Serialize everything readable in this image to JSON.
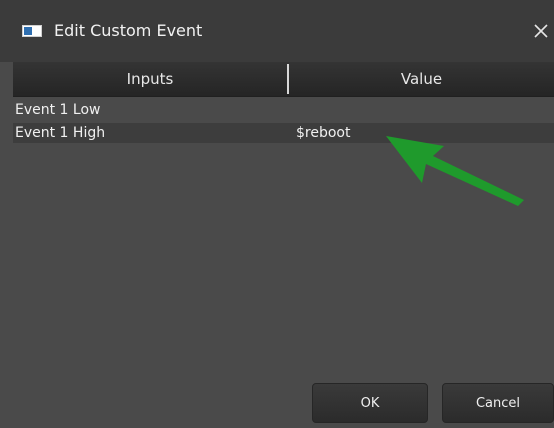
{
  "window": {
    "title": "Edit Custom Event",
    "close_glyph": "✕"
  },
  "table": {
    "columns": [
      "Inputs",
      "Value"
    ],
    "rows": [
      {
        "input": "Event 1 Low",
        "value": ""
      },
      {
        "input": "Event 1 High",
        "value": "$reboot"
      }
    ]
  },
  "annotation": {
    "icon": "green-arrow-icon",
    "color": "#1f9a2c"
  },
  "buttons": {
    "ok": "OK",
    "cancel": "Cancel"
  },
  "colors": {
    "dialog_bg": "#4a4a4a",
    "titlebar_bg": "#3b3b3b",
    "header_bg": "#2c2c2c",
    "selected_row_bg": "#3d3d3d",
    "text": "#f0f0f0"
  }
}
